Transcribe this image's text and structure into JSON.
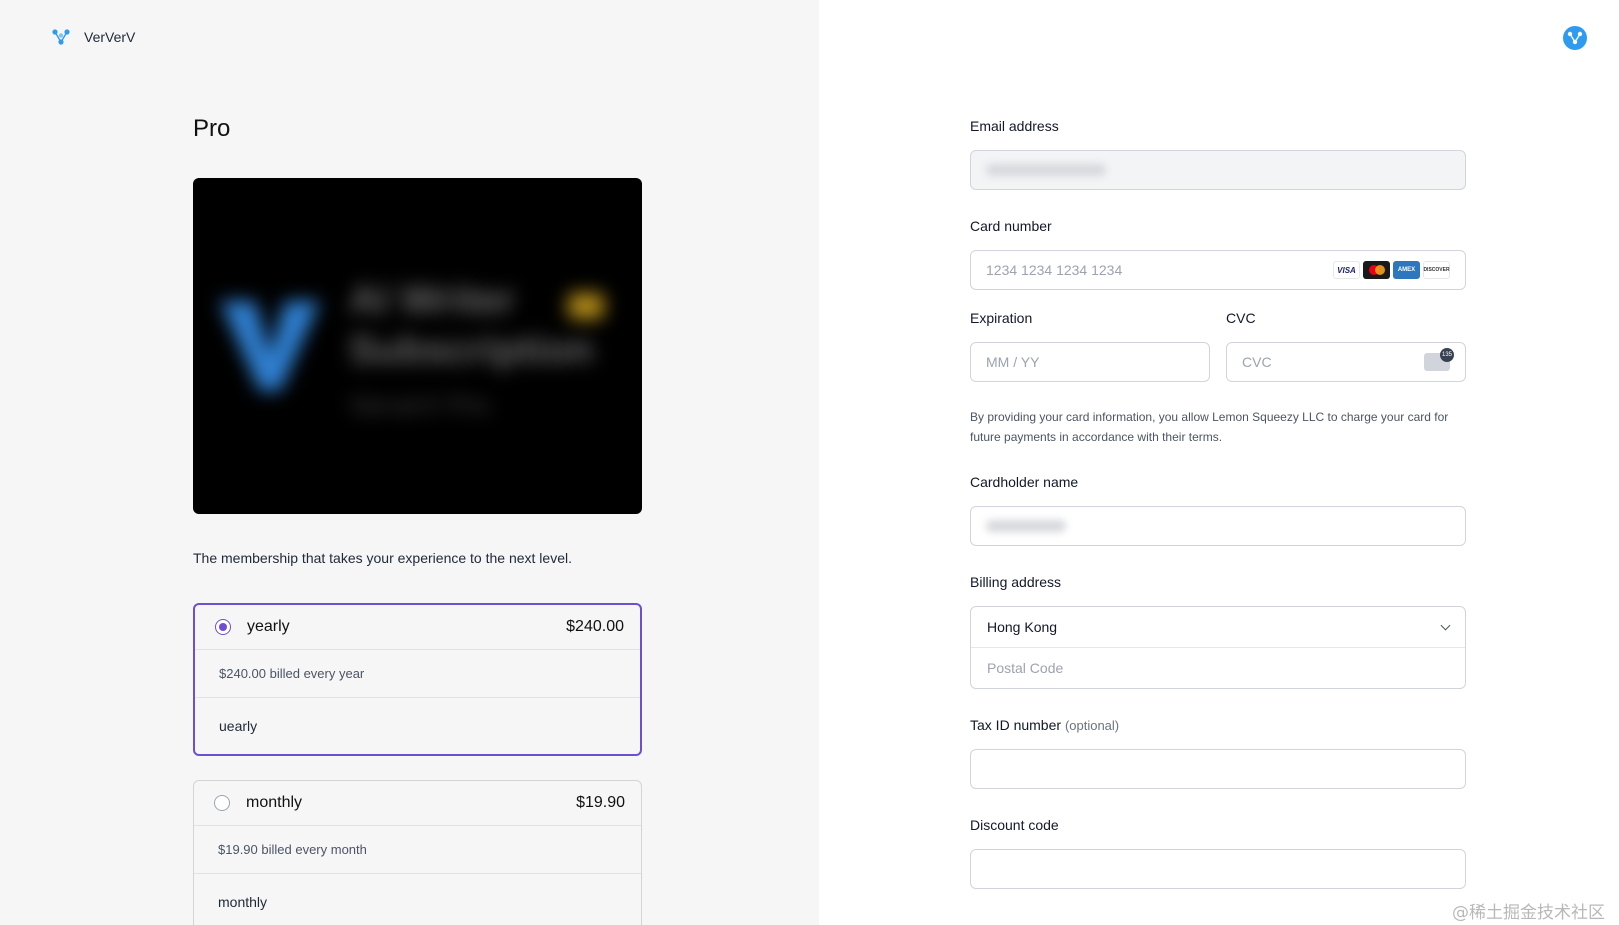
{
  "brand": {
    "name": "VerVerV"
  },
  "product": {
    "title": "Pro",
    "image_text": {
      "line1": "AI Writer",
      "line2": "Subscription",
      "line3": "VerverV Pro"
    },
    "description": "The membership that takes your experience to the next level."
  },
  "plans": [
    {
      "name": "yearly",
      "price": "$240.00",
      "billing": "$240.00 billed every year",
      "note": "uearly",
      "selected": true
    },
    {
      "name": "monthly",
      "price": "$19.90",
      "billing": "$19.90 billed every month",
      "note": "monthly",
      "selected": false
    }
  ],
  "checkout": {
    "email": {
      "label": "Email address"
    },
    "card_number": {
      "label": "Card number",
      "placeholder": "1234 1234 1234 1234",
      "brands": [
        "VISA",
        "mastercard",
        "AMEX",
        "DISCOVER"
      ]
    },
    "expiration": {
      "label": "Expiration",
      "placeholder": "MM / YY"
    },
    "cvc": {
      "label": "CVC",
      "placeholder": "CVC"
    },
    "terms": "By providing your card information, you allow Lemon Squeezy LLC to charge your card for future payments in accordance with their terms.",
    "cardholder": {
      "label": "Cardholder name"
    },
    "billing": {
      "label": "Billing address",
      "country": "Hong Kong",
      "postal_placeholder": "Postal Code"
    },
    "tax_id": {
      "label": "Tax ID number",
      "optional": "(optional)"
    },
    "discount": {
      "label": "Discount code"
    }
  },
  "watermark": "@稀土掘金技术社区",
  "colors": {
    "accent": "#6d4fd0",
    "brand_blue": "#2e9bf0"
  },
  "icons": [
    "ververv-logo-icon",
    "account-avatar-icon",
    "chevron-down-icon",
    "cvc-card-icon"
  ]
}
